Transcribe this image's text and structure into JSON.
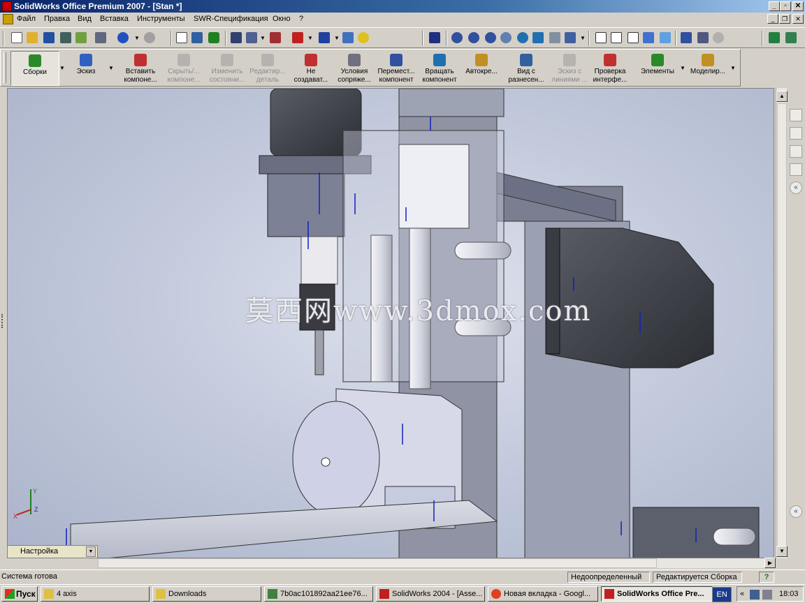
{
  "window": {
    "title": "SolidWorks Office Premium 2007 - [Stan *]"
  },
  "menu": {
    "items": [
      "Файл",
      "Правка",
      "Вид",
      "Вставка",
      "Инструменты",
      "SWR-Спецификация",
      "Окно",
      "?"
    ]
  },
  "command_manager": {
    "items": [
      {
        "label1": "Сборки",
        "label2": "",
        "state": "selected",
        "icon": "assembly-icon"
      },
      {
        "label1": "Эскиз",
        "label2": "",
        "state": "normal",
        "icon": "sketch-icon"
      },
      {
        "label1": "Вставить",
        "label2": "компоне...",
        "state": "normal",
        "icon": "insert-component-icon"
      },
      {
        "label1": "Скрыть/...",
        "label2": "компоне...",
        "state": "disabled",
        "icon": "hide-component-icon"
      },
      {
        "label1": "Изменить",
        "label2": "состояни...",
        "state": "disabled",
        "icon": "change-state-icon"
      },
      {
        "label1": "Редактир...",
        "label2": "деталь",
        "state": "disabled",
        "icon": "edit-part-icon"
      },
      {
        "label1": "Не",
        "label2": "создават...",
        "state": "normal",
        "icon": "no-external-refs-icon"
      },
      {
        "label1": "Условия",
        "label2": "сопряже...",
        "state": "normal",
        "icon": "mate-icon"
      },
      {
        "label1": "Перемест...",
        "label2": "компонент",
        "state": "normal",
        "icon": "move-component-icon"
      },
      {
        "label1": "Вращать",
        "label2": "компонент",
        "state": "normal",
        "icon": "rotate-component-icon"
      },
      {
        "label1": "Автокре...",
        "label2": "",
        "state": "normal",
        "icon": "smart-fasteners-icon"
      },
      {
        "label1": "Вид с",
        "label2": "разнесен...",
        "state": "normal",
        "icon": "exploded-view-icon"
      },
      {
        "label1": "Эскиз с",
        "label2": "линиями ...",
        "state": "disabled",
        "icon": "explode-line-sketch-icon"
      },
      {
        "label1": "Проверка",
        "label2": "интерфе...",
        "state": "normal",
        "icon": "interference-check-icon"
      },
      {
        "label1": "Элементы",
        "label2": "",
        "state": "normal",
        "icon": "features-icon"
      },
      {
        "label1": "Моделир...",
        "label2": "",
        "state": "normal",
        "icon": "simulation-icon"
      }
    ]
  },
  "viewport": {
    "watermark": "莫西网www.3dmox.com",
    "config_tab": "Настройка",
    "triad": {
      "x": "X",
      "y": "Y",
      "z": "Z"
    }
  },
  "status": {
    "message": "Система готова",
    "state1": "Недоопределенный",
    "state2": "Редактируется Сборка",
    "help": "?"
  },
  "taskbar": {
    "start": "Пуск",
    "tasks": [
      {
        "label": "4 axis",
        "icon": "folder-icon",
        "active": false
      },
      {
        "label": "Downloads",
        "icon": "folder-icon",
        "active": false
      },
      {
        "label": "7b0ac101892aa21ee76...",
        "icon": "image-icon",
        "active": false
      },
      {
        "label": "SolidWorks 2004 - [Asse...",
        "icon": "solidworks-icon",
        "active": false
      },
      {
        "label": "Новая вкладка - Googl...",
        "icon": "chrome-icon",
        "active": false
      },
      {
        "label": "SolidWorks Office Pre...",
        "icon": "solidworks-icon",
        "active": true
      }
    ],
    "lang": "EN",
    "clock": "18:03"
  },
  "colors": {
    "titlebar_start": "#0a246a",
    "titlebar_end": "#a6caf0",
    "chrome": "#d4d0c8",
    "dim_arrow": "#1020c0"
  }
}
